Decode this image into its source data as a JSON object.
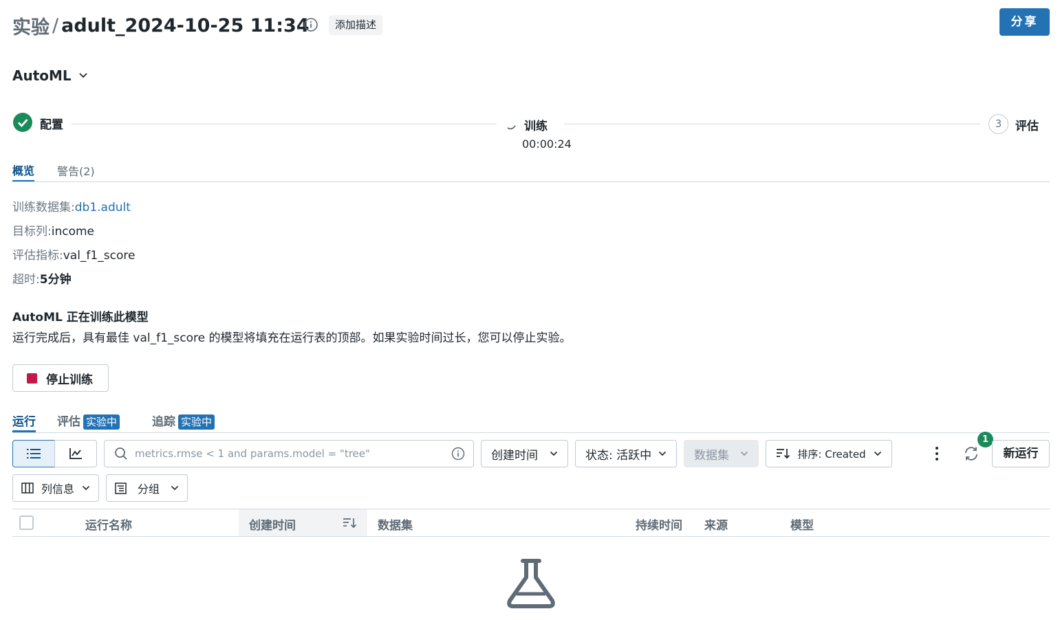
{
  "header": {
    "breadcrumb": "实验",
    "separator": "/",
    "experiment_name": "adult_2024-10-25 11:34",
    "add_description_label": "添加描述",
    "share_label": "分享"
  },
  "automl_selector": {
    "label": "AutoML"
  },
  "stepper": {
    "steps": [
      {
        "label": "配置",
        "status": "complete"
      },
      {
        "label": "训练",
        "status": "in-progress",
        "elapsed": "00:00:24"
      },
      {
        "label": "评估",
        "status": "pending",
        "number": "3"
      }
    ]
  },
  "tabs": {
    "overview": "概览",
    "warnings": "警告(2)"
  },
  "details": {
    "dataset_label": "训练数据集:",
    "dataset_value": "db1.adult",
    "target_label": "目标列:",
    "target_value": "income",
    "metric_label": "评估指标:",
    "metric_value": "val_f1_score",
    "timeout_label": "超时:",
    "timeout_value": "5分钟"
  },
  "training_notice": {
    "title": "AutoML 正在训练此模型",
    "description": "运行完成后，具有最佳 val_f1_score 的模型将填充在运行表的顶部。如果实验时间过长，您可以停止实验。"
  },
  "stop_button": {
    "label": "停止训练"
  },
  "run_tabs": {
    "runs": "运行",
    "evaluation": "评估",
    "evaluation_badge": "实验中",
    "tracing": "追踪",
    "tracing_badge": "实验中"
  },
  "toolbar": {
    "search_placeholder": "metrics.rmse < 1 and params.model = \"tree\"",
    "created_time_label": "创建时间",
    "status_label": "状态: 活跃中",
    "dataset_label": "数据集",
    "sort_label": "排序: Created",
    "refresh_badge_count": "1",
    "new_run_label": "新运行",
    "columns_label": "列信息",
    "group_label": "分组"
  },
  "table": {
    "columns": [
      "运行名称",
      "创建时间",
      "数据集",
      "持续时间",
      "来源",
      "模型"
    ]
  },
  "colors": {
    "accent": "#2272b4",
    "success": "#1b8a5a",
    "danger": "#c6174b"
  }
}
